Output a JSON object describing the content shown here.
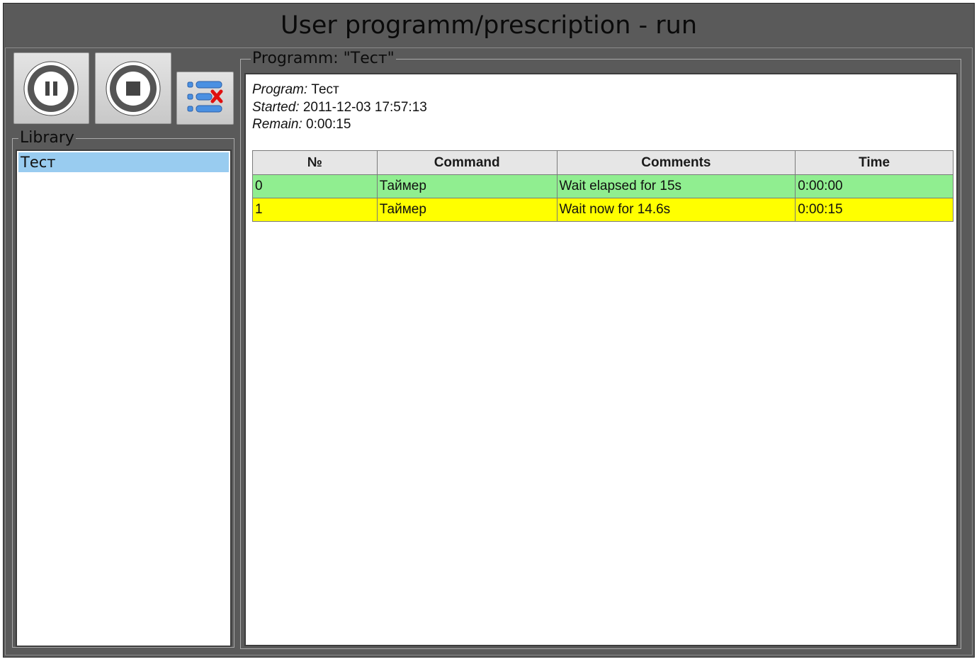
{
  "window": {
    "title": "User programm/prescription - run"
  },
  "toolbar": {
    "pause_icon": "pause-circle-icon",
    "stop_icon": "stop-circle-icon",
    "clear_icon": "list-remove-icon"
  },
  "library": {
    "label": "Library",
    "items": [
      {
        "label": "Тест",
        "selected": true
      }
    ]
  },
  "program": {
    "group_label": "Programm: \"Тест\"",
    "info": {
      "program_label": "Program:",
      "program_value": "Тест",
      "started_label": "Started:",
      "started_value": "2011-12-03 17:57:13",
      "remain_label": "Remain:",
      "remain_value": "0:00:15"
    },
    "table": {
      "headers": [
        "№",
        "Command",
        "Comments",
        "Time"
      ],
      "rows": [
        {
          "n": "0",
          "command": "Таймер",
          "comments": "Wait elapsed for 15s",
          "time": "0:00:00",
          "state": "done"
        },
        {
          "n": "1",
          "command": "Таймер",
          "comments": "Wait now for 14.6s",
          "time": "0:00:15",
          "state": "active"
        }
      ]
    }
  },
  "colors": {
    "background": "#5a5a5a",
    "selected_item": "#99ccf0",
    "row_done": "#90ee90",
    "row_active": "#ffff00"
  }
}
